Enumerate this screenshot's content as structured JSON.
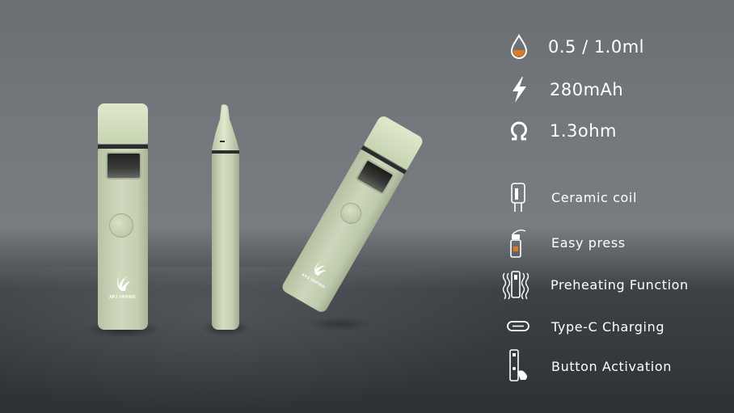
{
  "specs": {
    "capacity": "0.5 / 1.0ml",
    "battery": "280mAh",
    "resistance": "1.3ohm"
  },
  "features": [
    {
      "label": "Ceramic coil",
      "icon": "ceramic-coil-icon"
    },
    {
      "label": "Easy press",
      "icon": "easy-press-icon"
    },
    {
      "label": "Preheating Function",
      "icon": "preheating-icon"
    },
    {
      "label": "Type-C Charging",
      "icon": "type-c-icon"
    },
    {
      "label": "Button  Activation",
      "icon": "button-activation-icon"
    }
  ],
  "product": {
    "brand": "APJ VAPING"
  },
  "colors": {
    "text": "#ffffff",
    "device_body": "#c9d4b6",
    "accent_orange": "#e07a1f"
  }
}
